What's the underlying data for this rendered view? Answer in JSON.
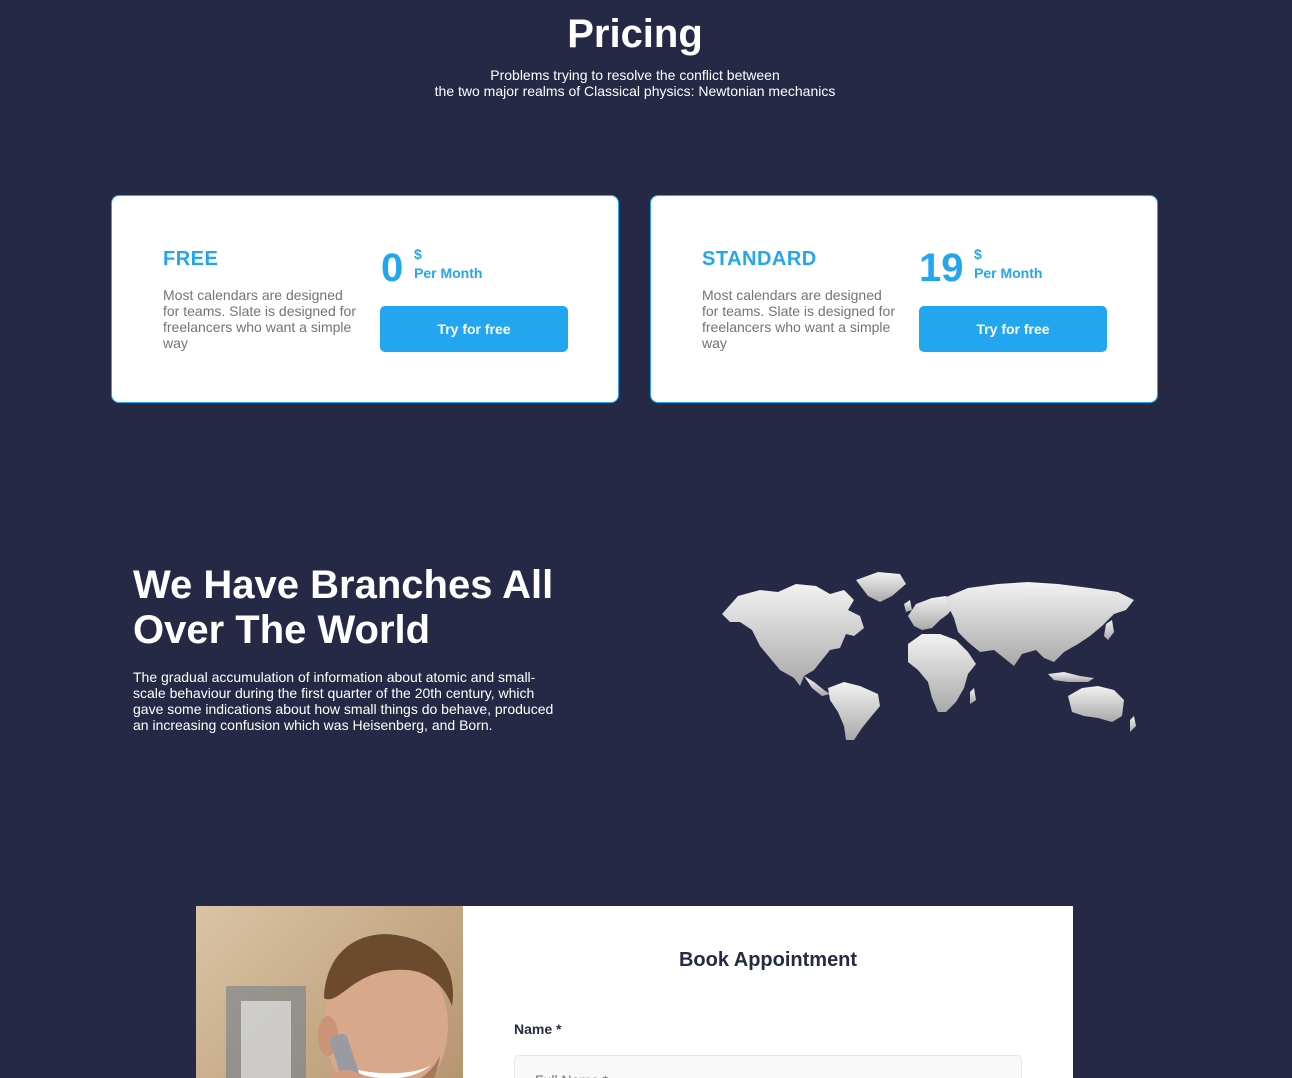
{
  "pricing": {
    "title": "Pricing",
    "subtitle_line1": "Problems trying to resolve the conflict between",
    "subtitle_line2": "the two major realms of Classical physics: Newtonian mechanics"
  },
  "plans": [
    {
      "name": "FREE",
      "description": "Most calendars are designed for teams. Slate is designed for freelancers who want a simple way",
      "price": "0",
      "currency": "$",
      "period": "Per Month",
      "button_label": "Try for free"
    },
    {
      "name": "STANDARD",
      "description": "Most calendars are designed for teams. Slate is designed for freelancers who want a simple way",
      "price": "19",
      "currency": "$",
      "period": "Per Month",
      "button_label": "Try for free"
    }
  ],
  "branches": {
    "title": "We Have Branches All Over The World",
    "text": "The gradual accumulation of information about atomic and small-scale behaviour during the first quarter of the 20th century, which gave some indications about how small things do behave, produced an increasing confusion which was Heisenberg, and Born."
  },
  "appointment": {
    "title": "Book Appointment",
    "name_label": "Name *",
    "name_placeholder": "Full Name *"
  },
  "colors": {
    "background": "#252945",
    "accent": "#23a6f0",
    "heading_dark": "#252b42",
    "muted_text": "#737373"
  }
}
